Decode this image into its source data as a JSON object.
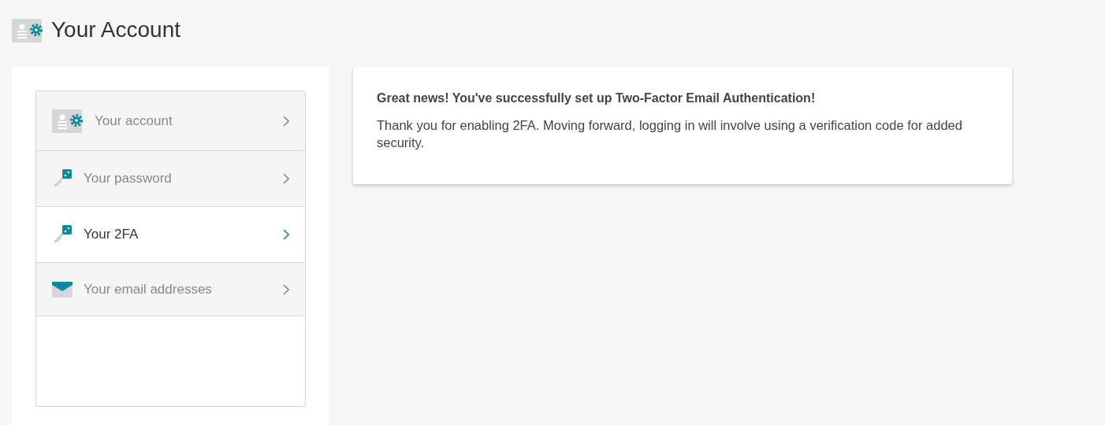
{
  "page_title": "Your Account",
  "menu": [
    {
      "label": "Your account",
      "kind": "account",
      "selected": false
    },
    {
      "label": "Your password",
      "kind": "key",
      "selected": false
    },
    {
      "label": "Your 2FA",
      "kind": "key",
      "selected": true
    },
    {
      "label": "Your email addresses",
      "kind": "email",
      "selected": false
    }
  ],
  "message": {
    "heading": "Great news! You've successfully set up Two-Factor Email Authentication!",
    "body": "Thank you for enabling 2FA. Moving forward, logging in will involve using a verification code for added security."
  }
}
